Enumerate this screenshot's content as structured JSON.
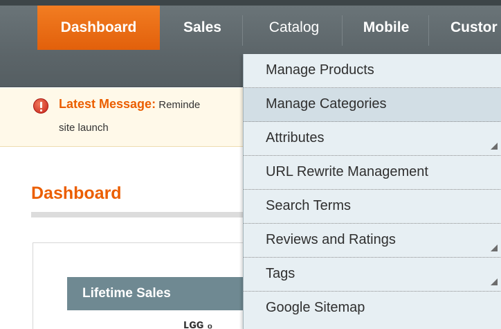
{
  "nav": {
    "items": [
      {
        "label": "Dashboard"
      },
      {
        "label": "Sales"
      },
      {
        "label": "Catalog"
      },
      {
        "label": "Mobile"
      },
      {
        "label": "Custor"
      }
    ]
  },
  "message": {
    "label": "Latest Message",
    "separator": ":",
    "text_part1": " Reminde",
    "text_part2": "site launch"
  },
  "page": {
    "title": "Dashboard"
  },
  "lifetime_sales": {
    "heading": "Lifetime Sales",
    "value": "ʟɢɢ ₀"
  },
  "catalog_menu": {
    "items": [
      {
        "label": "Manage Products"
      },
      {
        "label": "Manage Categories"
      },
      {
        "label": "Attributes"
      },
      {
        "label": "URL Rewrite Management"
      },
      {
        "label": "Search Terms"
      },
      {
        "label": "Reviews and Ratings"
      },
      {
        "label": "Tags"
      },
      {
        "label": "Google Sitemap"
      }
    ]
  },
  "colors": {
    "accent": "#eb5e00",
    "nav_bg": "#5c6569",
    "menu_bg": "#e7eff3",
    "table_head": "#6f8992"
  }
}
